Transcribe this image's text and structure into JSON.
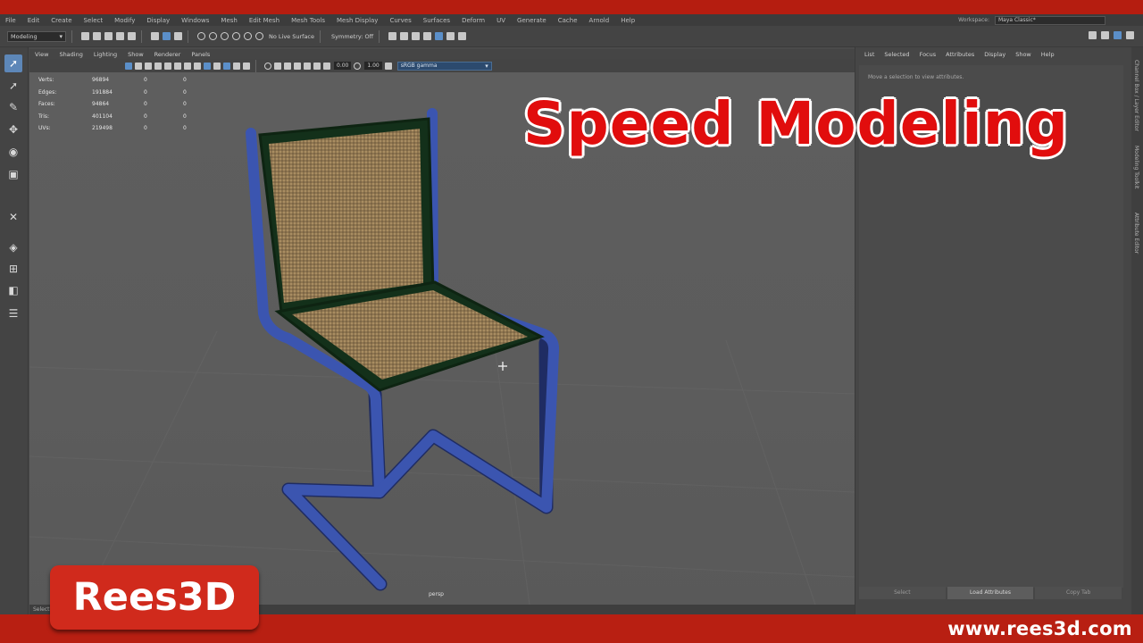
{
  "menubar": {
    "items": [
      "File",
      "Edit",
      "Create",
      "Select",
      "Modify",
      "Display",
      "Windows",
      "Mesh",
      "Edit Mesh",
      "Mesh Tools",
      "Mesh Display",
      "Curves",
      "Surfaces",
      "Deform",
      "UV",
      "Generate",
      "Cache",
      "Arnold",
      "Help"
    ],
    "workspace_label": "Workspace:",
    "workspace_value": "Maya Classic*"
  },
  "statusline": {
    "mode": "Modeling",
    "live_surface": "No Live Surface",
    "symmetry": "Symmetry: Off"
  },
  "viewport": {
    "menu": [
      "View",
      "Shading",
      "Lighting",
      "Show",
      "Renderer",
      "Panels"
    ],
    "field1": "0.00",
    "field2": "1.00",
    "color_space": "sRGB gamma",
    "camera_label": "persp",
    "hud": [
      {
        "label": "Verts:",
        "v1": "96894",
        "v2": "0",
        "v3": "0"
      },
      {
        "label": "Edges:",
        "v1": "191884",
        "v2": "0",
        "v3": "0"
      },
      {
        "label": "Faces:",
        "v1": "94864",
        "v2": "0",
        "v3": "0"
      },
      {
        "label": "Tris:",
        "v1": "401104",
        "v2": "0",
        "v3": "0"
      },
      {
        "label": "UVs:",
        "v1": "219498",
        "v2": "0",
        "v3": "0"
      }
    ]
  },
  "attribute_panel": {
    "menu": [
      "List",
      "Selected",
      "Focus",
      "Attributes",
      "Display",
      "Show",
      "Help"
    ],
    "hint": "Move a selection to view attributes.",
    "buttons": [
      "Select",
      "Load Attributes",
      "Copy Tab"
    ],
    "side_tabs": [
      "Channel Box / Layer Editor",
      "Modeling Toolkit",
      "Attribute Editor"
    ]
  },
  "timeline_label": "Selection",
  "overlay": {
    "title": "Speed Modeling",
    "badge": "Rees3D",
    "url": "www.rees3d.com"
  },
  "colors": {
    "brand_red": "#b81f12",
    "title_red": "#e10d0d",
    "chair_frame": "#3a51a8",
    "seat_trim": "#1c3a1c",
    "cane": "#9b7f55"
  }
}
